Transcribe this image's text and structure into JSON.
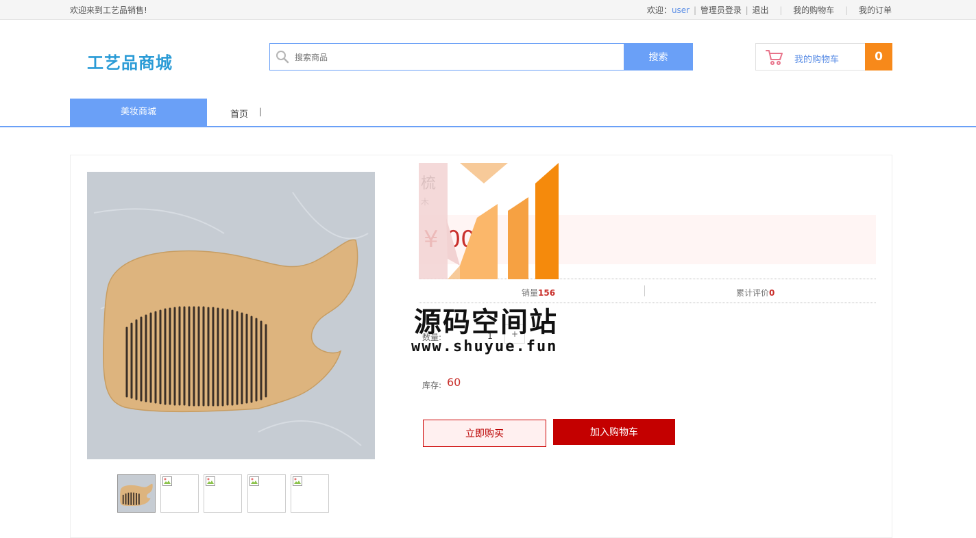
{
  "topbar": {
    "welcome": "欢迎来到工艺品销售!",
    "greeting": "欢迎：",
    "username": "user",
    "admin_login": "管理员登录",
    "logout": "退出",
    "my_cart": "我的购物车",
    "my_orders": "我的订单"
  },
  "header": {
    "logo": "工艺品商城",
    "search_placeholder": "搜索商品",
    "search_button": "搜索",
    "cart_label": "我的购物车",
    "cart_count": "0"
  },
  "nav": {
    "active": "美妆商城",
    "home": "首页",
    "separator": "|"
  },
  "product": {
    "title": "梳",
    "subtitle": "木",
    "price": "¥ 000",
    "sales_label": "销量",
    "sales_value": "156",
    "reviews_label": "累计评价",
    "reviews_value": "0",
    "quantity_label": "数量:",
    "quantity_value": "1",
    "plus": "+",
    "stock_label": "库存:",
    "stock_value": "60",
    "buy_now": "立即购买",
    "add_to_cart": "加入购物车"
  },
  "watermark": {
    "text_cn": "源码空间站",
    "url": "www.shuyue.fun"
  },
  "colors": {
    "accent_blue": "#6aa0f7",
    "cart_orange": "#f7891a",
    "price_red": "#c9302c",
    "add_cart_red": "#c40000"
  }
}
